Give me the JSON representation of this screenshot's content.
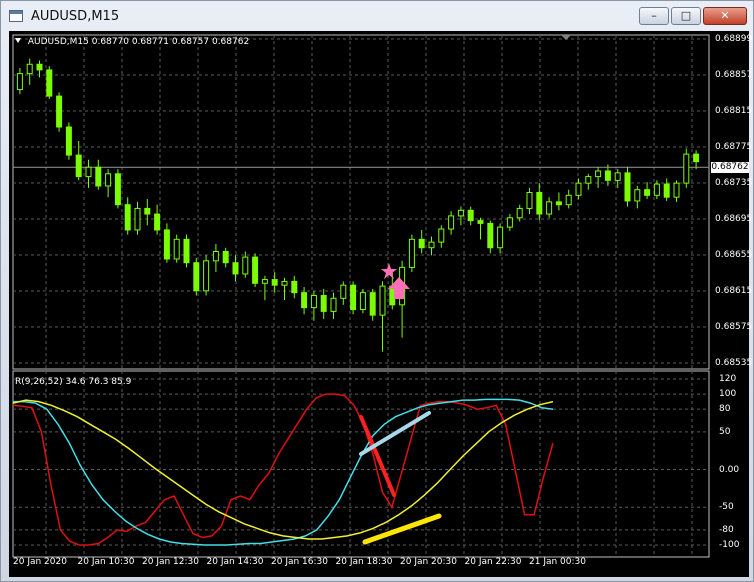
{
  "window": {
    "title": "AUDUSD,M15",
    "buttons": {
      "minimize": "–",
      "maximize": "□",
      "close": "✕"
    }
  },
  "chart_header": {
    "symbol_label": "AUDUSD,M15",
    "ohlc": "0.68770 0.68771 0.68757 0.68762"
  },
  "oscillator_header": "R(9,26,52) 34.6 76.3 85.9",
  "last_price": "0.68762",
  "colors": {
    "background": "#000000",
    "candle_up": "#000000",
    "candle_outline": "#7cfc00",
    "grid": "#5a5a5a",
    "red_line": "#e01010",
    "cyan_line": "#40e0e8",
    "yellow_line": "#f0f030",
    "annotation_pink": "#ff6fb5",
    "annotation_red": "#ff2020",
    "annotation_lightblue": "#a8d8ea",
    "annotation_yellow": "#ffe600"
  },
  "chart_data": [
    {
      "type": "candlestick",
      "title": "AUDUSD,M15",
      "ylim": [
        0.68555,
        0.68899
      ],
      "y_ticks": [
        "0.68899",
        "0.68857",
        "0.68815",
        "0.68775",
        "0.68735",
        "0.68695",
        "0.68655",
        "0.68615",
        "0.68575",
        "0.68535"
      ],
      "x_ticks": [
        "20 Jan 2020",
        "20 Jan 10:30",
        "20 Jan 12:30",
        "20 Jan 14:30",
        "20 Jan 16:30",
        "20 Jan 18:30",
        "20 Jan 20:30",
        "20 Jan 22:30",
        "21 Jan 00:30"
      ],
      "ohlc": [
        [
          0.68845,
          0.68868,
          0.6884,
          0.68862
        ],
        [
          0.68862,
          0.68878,
          0.6885,
          0.68872
        ],
        [
          0.68872,
          0.68876,
          0.68858,
          0.68866
        ],
        [
          0.68866,
          0.6887,
          0.68835,
          0.68838
        ],
        [
          0.68838,
          0.68842,
          0.688,
          0.68805
        ],
        [
          0.68805,
          0.6881,
          0.6877,
          0.68775
        ],
        [
          0.68775,
          0.6879,
          0.68748,
          0.68752
        ],
        [
          0.68752,
          0.6877,
          0.6874,
          0.68762
        ],
        [
          0.68762,
          0.6877,
          0.68738,
          0.68742
        ],
        [
          0.68742,
          0.6876,
          0.6873,
          0.68755
        ],
        [
          0.68755,
          0.6876,
          0.68718,
          0.68722
        ],
        [
          0.68722,
          0.6873,
          0.6869,
          0.68695
        ],
        [
          0.68695,
          0.68725,
          0.6869,
          0.68718
        ],
        [
          0.68718,
          0.68728,
          0.687,
          0.68712
        ],
        [
          0.68712,
          0.68722,
          0.6869,
          0.68695
        ],
        [
          0.68695,
          0.68702,
          0.6866,
          0.68664
        ],
        [
          0.68664,
          0.6869,
          0.6866,
          0.68685
        ],
        [
          0.68685,
          0.6869,
          0.68655,
          0.6866
        ],
        [
          0.6866,
          0.68665,
          0.68625,
          0.6863
        ],
        [
          0.6863,
          0.68668,
          0.68625,
          0.68662
        ],
        [
          0.68662,
          0.6868,
          0.6865,
          0.68672
        ],
        [
          0.68672,
          0.68676,
          0.68655,
          0.6866
        ],
        [
          0.6866,
          0.68668,
          0.6864,
          0.68648
        ],
        [
          0.68648,
          0.68672,
          0.68644,
          0.68666
        ],
        [
          0.68666,
          0.6867,
          0.68634,
          0.68638
        ],
        [
          0.68638,
          0.68646,
          0.6862,
          0.68642
        ],
        [
          0.68642,
          0.6865,
          0.68628,
          0.68636
        ],
        [
          0.68636,
          0.68644,
          0.6862,
          0.6864
        ],
        [
          0.6864,
          0.68646,
          0.68622,
          0.68628
        ],
        [
          0.68628,
          0.68634,
          0.68605,
          0.68612
        ],
        [
          0.68612,
          0.6863,
          0.68598,
          0.68625
        ],
        [
          0.68625,
          0.68632,
          0.686,
          0.68608
        ],
        [
          0.68608,
          0.68628,
          0.686,
          0.68622
        ],
        [
          0.68622,
          0.6864,
          0.68615,
          0.68636
        ],
        [
          0.68636,
          0.6864,
          0.68605,
          0.6861
        ],
        [
          0.6861,
          0.68632,
          0.68606,
          0.68628
        ],
        [
          0.68628,
          0.68632,
          0.68598,
          0.68604
        ],
        [
          0.68604,
          0.6864,
          0.68565,
          0.68635
        ],
        [
          0.68635,
          0.6865,
          0.6861,
          0.68615
        ],
        [
          0.68615,
          0.68662,
          0.6858,
          0.68655
        ],
        [
          0.68655,
          0.6869,
          0.6865,
          0.68685
        ],
        [
          0.68685,
          0.68695,
          0.6867,
          0.68676
        ],
        [
          0.68676,
          0.68688,
          0.68668,
          0.68682
        ],
        [
          0.68682,
          0.687,
          0.68676,
          0.68696
        ],
        [
          0.68696,
          0.68715,
          0.6869,
          0.6871
        ],
        [
          0.6871,
          0.6872,
          0.687,
          0.68716
        ],
        [
          0.68716,
          0.6872,
          0.687,
          0.68705
        ],
        [
          0.68705,
          0.68708,
          0.68685,
          0.68702
        ],
        [
          0.68702,
          0.68705,
          0.6867,
          0.68676
        ],
        [
          0.68676,
          0.68702,
          0.6867,
          0.68698
        ],
        [
          0.68698,
          0.68712,
          0.68694,
          0.68708
        ],
        [
          0.68708,
          0.68722,
          0.68704,
          0.68718
        ],
        [
          0.68718,
          0.6874,
          0.68712,
          0.68735
        ],
        [
          0.68735,
          0.68745,
          0.68705,
          0.68712
        ],
        [
          0.68712,
          0.6873,
          0.68708,
          0.68725
        ],
        [
          0.68725,
          0.68735,
          0.68716,
          0.68722
        ],
        [
          0.68722,
          0.68738,
          0.68718,
          0.68732
        ],
        [
          0.68732,
          0.6875,
          0.68728,
          0.68745
        ],
        [
          0.68745,
          0.68755,
          0.68738,
          0.68752
        ],
        [
          0.68752,
          0.68762,
          0.6874,
          0.68758
        ],
        [
          0.68758,
          0.68765,
          0.68742,
          0.68748
        ],
        [
          0.68748,
          0.6876,
          0.6874,
          0.68756
        ],
        [
          0.68756,
          0.68762,
          0.6872,
          0.68726
        ],
        [
          0.68726,
          0.68742,
          0.68718,
          0.68738
        ],
        [
          0.68738,
          0.68746,
          0.68728,
          0.68732
        ],
        [
          0.68732,
          0.68748,
          0.68728,
          0.68744
        ],
        [
          0.68744,
          0.6875,
          0.68726,
          0.6873
        ],
        [
          0.6873,
          0.68748,
          0.68725,
          0.68745
        ],
        [
          0.68745,
          0.68782,
          0.6874,
          0.68776
        ],
        [
          0.68776,
          0.6878,
          0.6876,
          0.68768
        ]
      ]
    },
    {
      "type": "line",
      "title": "R(9,26,52) 34.6 76.3 85.9",
      "ylim": [
        -100,
        120
      ],
      "y_ticks": [
        "120",
        "100",
        "80",
        "50",
        "0.00",
        "-50",
        "-80",
        "-100"
      ],
      "series": [
        {
          "color": "#e01010",
          "values": [
            85,
            84,
            82,
            50,
            -20,
            -80,
            -95,
            -100,
            -100,
            -98,
            -90,
            -80,
            -82,
            -75,
            -70,
            -55,
            -40,
            -35,
            -60,
            -85,
            -90,
            -88,
            -75,
            -40,
            -35,
            -40,
            -20,
            -5,
            20,
            40,
            60,
            80,
            95,
            100,
            100,
            98,
            85,
            60,
            20,
            -30,
            -50,
            -5,
            40,
            85,
            88,
            90,
            90,
            88,
            85,
            80,
            82,
            85,
            60,
            0,
            -60,
            -60,
            -10,
            35
          ]
        },
        {
          "color": "#40e0e8",
          "values": [
            90,
            90,
            88,
            80,
            60,
            35,
            5,
            -20,
            -40,
            -55,
            -68,
            -78,
            -86,
            -92,
            -96,
            -98,
            -99,
            -100,
            -100,
            -100,
            -99,
            -98,
            -98,
            -96,
            -94,
            -92,
            -88,
            -80,
            -62,
            -40,
            -10,
            20,
            45,
            60,
            70,
            76,
            82,
            86,
            88,
            90,
            92,
            92,
            93,
            93,
            93,
            92,
            88,
            82,
            80
          ]
        },
        {
          "color": "#f0f030",
          "values": [
            88,
            92,
            90,
            85,
            78,
            70,
            60,
            50,
            40,
            28,
            15,
            2,
            -10,
            -22,
            -34,
            -46,
            -56,
            -64,
            -72,
            -78,
            -84,
            -88,
            -90,
            -92,
            -92,
            -90,
            -88,
            -84,
            -78,
            -70,
            -60,
            -48,
            -34,
            -18,
            0,
            18,
            34,
            50,
            62,
            72,
            80,
            86,
            90
          ]
        }
      ]
    }
  ]
}
